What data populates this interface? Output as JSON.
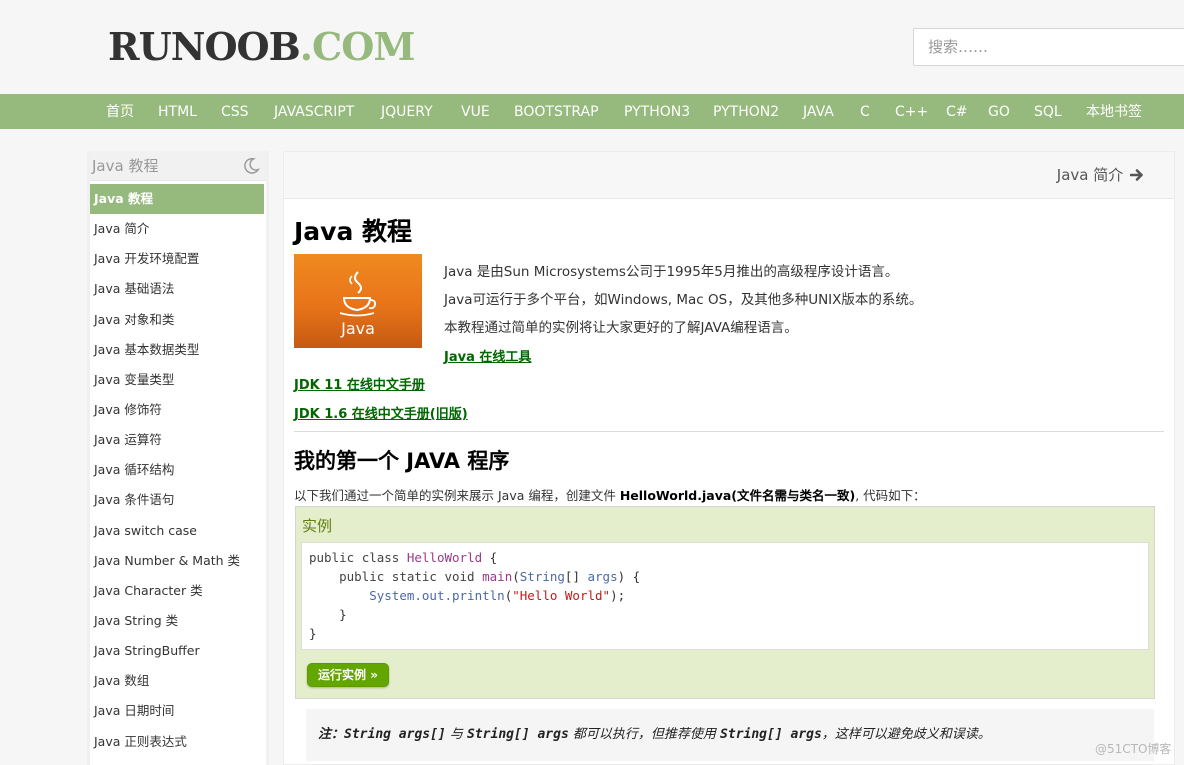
{
  "header": {
    "logo_part1": "RUNOOB",
    "logo_part2": ".COM",
    "search_placeholder": "搜索……"
  },
  "nav": [
    "首页",
    "HTML",
    "CSS",
    "JAVASCRIPT",
    "JQUERY",
    "VUE",
    "BOOTSTRAP",
    "PYTHON3",
    "PYTHON2",
    "JAVA",
    "C",
    "C++",
    "C#",
    "GO",
    "SQL",
    "本地书签"
  ],
  "sidebar": {
    "title": "Java 教程",
    "items": [
      "Java 教程",
      "Java 简介",
      "Java 开发环境配置",
      "Java 基础语法",
      "Java 对象和类",
      "Java 基本数据类型",
      "Java 变量类型",
      "Java 修饰符",
      "Java 运算符",
      "Java 循环结构",
      "Java 条件语句",
      "Java switch case",
      "Java Number & Math 类",
      "Java Character 类",
      "Java String 类",
      "Java StringBuffer",
      "Java 数组",
      "Java 日期时间",
      "Java 正则表达式"
    ],
    "active_index": 0
  },
  "main": {
    "next_link": "Java 简介",
    "title": "Java 教程",
    "logo_text": "Java",
    "intro": [
      "Java 是由Sun Microsystems公司于1995年5月推出的高级程序设计语言。",
      "Java可运行于多个平台，如Windows, Mac OS，及其他多种UNIX版本的系统。",
      "本教程通过简单的实例将让大家更好的了解JAVA编程语言。"
    ],
    "online_tool": "Java 在线工具",
    "jdk11": "JDK 11 在线中文手册",
    "jdk16": "JDK 1.6 在线中文手册(旧版)",
    "section_title": "我的第一个 JAVA 程序",
    "lead_pre": "以下我们通过一个简单的实例来展示 Java 编程，创建文件 ",
    "lead_bold": "HelloWorld.java(文件名需与类名一致)",
    "lead_post": ", 代码如下：",
    "example_title": "实例",
    "run_button": "运行实例 »",
    "note_label": "注：",
    "note_code1": "String args[]",
    "note_t1": " 与 ",
    "note_code2": "String[] args",
    "note_t2": " 都可以执行，但推荐使用 ",
    "note_code3": "String[] args",
    "note_t3": "，这样可以避免歧义和误读。"
  },
  "code": {
    "kw_public": "public",
    "kw_class": "class",
    "class_name": "HelloWorld",
    "kw_static": "static",
    "kw_void": "void",
    "main": "main",
    "type_string": "String",
    "args": "args",
    "println": "System.out.println",
    "string_literal": "\"Hello World\""
  },
  "watermark": "@51CTO博客",
  "colors": {
    "brand_green": "#96b97d",
    "link_green": "#006600",
    "example_bg": "#e5eecc",
    "run_button": "#64a600"
  }
}
